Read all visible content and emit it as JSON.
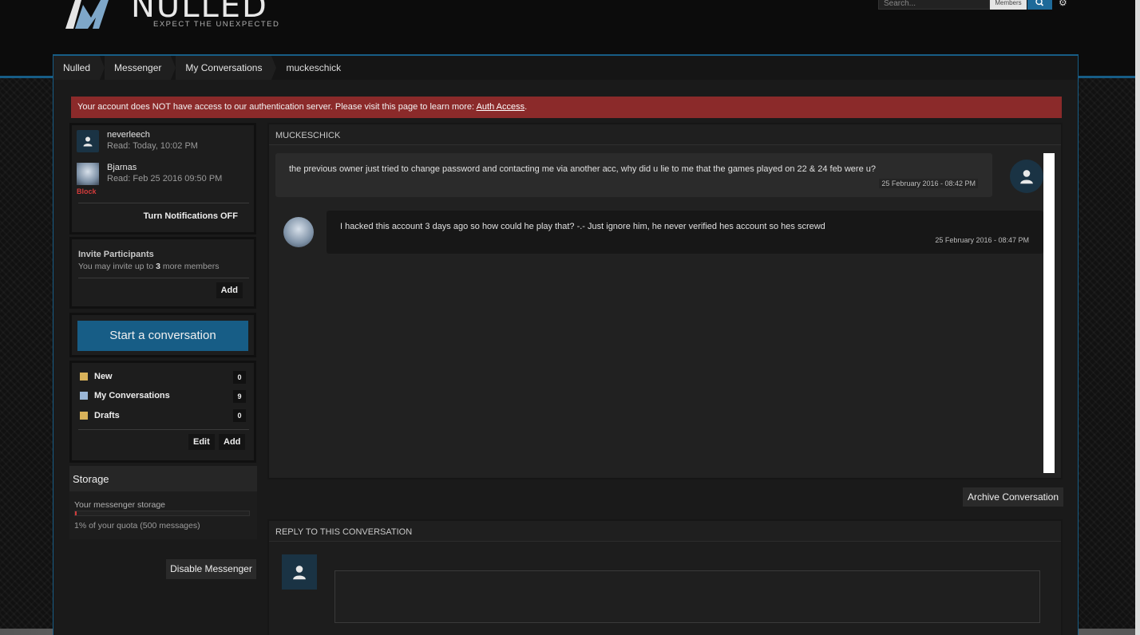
{
  "header": {
    "logo_title": "NULLED",
    "logo_tagline": "EXPECT THE UNEXPECTED",
    "search_placeholder": "Search...",
    "search_scope": "Members"
  },
  "breadcrumb": [
    "Nulled",
    "Messenger",
    "My Conversations",
    "muckeschick"
  ],
  "alert": {
    "text": "Your account does NOT have access to our authentication server. Please visit this page to learn more: ",
    "link": "Auth Access",
    "suffix": "."
  },
  "participants": [
    {
      "name": "neverleech",
      "read": "Read: Today, 10:02 PM"
    },
    {
      "name": "Bjarnas",
      "read": "Read: Feb 25 2016 09:50 PM"
    }
  ],
  "block_label": "Block",
  "notifications": {
    "prefix": "Turn Notifications ",
    "state": "OFF"
  },
  "invite": {
    "title": "Invite Participants",
    "sub_prefix": "You may invite up to ",
    "count": "3",
    "sub_suffix": " more members",
    "add_label": "Add"
  },
  "start_conversation": "Start a conversation",
  "folders": [
    {
      "label": "New",
      "count": "0"
    },
    {
      "label": "My Conversations",
      "count": "9"
    },
    {
      "label": "Drafts",
      "count": "0"
    }
  ],
  "folder_actions": {
    "edit": "Edit",
    "add": "Add"
  },
  "storage": {
    "title": "Storage",
    "label": "Your messenger storage",
    "quota_text": "1% of your quota (500 messages)",
    "percent": 1
  },
  "disable_messenger": "Disable Messenger",
  "conversation": {
    "title": "MUCKESCHICK",
    "messages": [
      {
        "text": "the previous owner just tried to change password and contacting me via another acc, why did u lie to me that the games played on 22 & 24 feb were u?",
        "time": "25 February 2016 - 08:42 PM"
      },
      {
        "text": "I hacked this account 3 days ago so how could he play that? -.- Just ignore him, he never verified hes account so hes screwd",
        "time": "25 February 2016 - 08:47 PM"
      }
    ]
  },
  "archive_label": "Archive Conversation",
  "reply_title": "REPLY TO THIS CONVERSATION",
  "icons": [
    "search-icon",
    "gear-icon",
    "user-icon",
    "folder-icon",
    "envelope-icon"
  ]
}
